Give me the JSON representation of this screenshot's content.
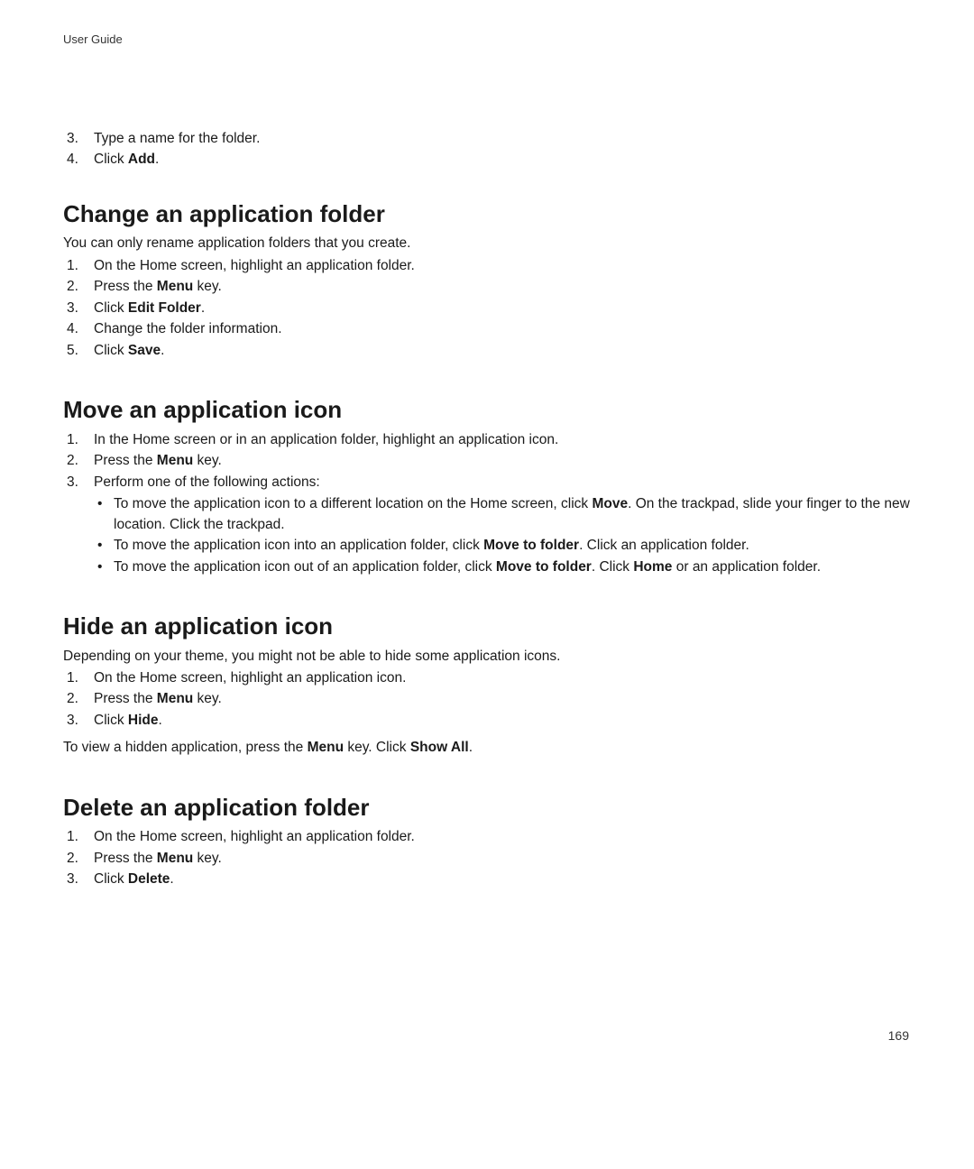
{
  "header": {
    "label": "User Guide"
  },
  "page_number": "169",
  "prelude_steps": {
    "start": 3,
    "items": [
      {
        "text": "Type a name for the folder."
      },
      {
        "runs": [
          {
            "t": "Click "
          },
          {
            "t": "Add",
            "b": true
          },
          {
            "t": "."
          }
        ]
      }
    ]
  },
  "sections": [
    {
      "heading": "Change an application folder",
      "intro": "You can only rename application folders that you create.",
      "steps": [
        {
          "text": "On the Home screen, highlight an application folder."
        },
        {
          "runs": [
            {
              "t": "Press the "
            },
            {
              "t": "Menu",
              "b": true
            },
            {
              "t": " key."
            }
          ]
        },
        {
          "runs": [
            {
              "t": "Click "
            },
            {
              "t": "Edit Folder",
              "b": true
            },
            {
              "t": "."
            }
          ]
        },
        {
          "text": "Change the folder information."
        },
        {
          "runs": [
            {
              "t": "Click "
            },
            {
              "t": "Save",
              "b": true
            },
            {
              "t": "."
            }
          ]
        }
      ]
    },
    {
      "heading": "Move an application icon",
      "steps": [
        {
          "text": "In the Home screen or in an application folder, highlight an application icon."
        },
        {
          "runs": [
            {
              "t": "Press the "
            },
            {
              "t": "Menu",
              "b": true
            },
            {
              "t": " key."
            }
          ]
        },
        {
          "text": "Perform one of the following actions:",
          "bullets": [
            {
              "runs": [
                {
                  "t": "To move the application icon to a different location on the Home screen, click "
                },
                {
                  "t": "Move",
                  "b": true
                },
                {
                  "t": ". On the trackpad, slide your finger to the new location. Click the trackpad."
                }
              ]
            },
            {
              "runs": [
                {
                  "t": "To move the application icon into an application folder, click "
                },
                {
                  "t": "Move to folder",
                  "b": true
                },
                {
                  "t": ". Click an application folder."
                }
              ]
            },
            {
              "runs": [
                {
                  "t": "To move the application icon out of an application folder, click "
                },
                {
                  "t": "Move to folder",
                  "b": true
                },
                {
                  "t": ". Click "
                },
                {
                  "t": "Home",
                  "b": true
                },
                {
                  "t": " or an application folder."
                }
              ]
            }
          ]
        }
      ]
    },
    {
      "heading": "Hide an application icon",
      "intro": "Depending on your theme, you might not be able to hide some application icons.",
      "steps": [
        {
          "text": "On the Home screen, highlight an application icon."
        },
        {
          "runs": [
            {
              "t": "Press the "
            },
            {
              "t": "Menu",
              "b": true
            },
            {
              "t": " key."
            }
          ]
        },
        {
          "runs": [
            {
              "t": "Click "
            },
            {
              "t": "Hide",
              "b": true
            },
            {
              "t": "."
            }
          ]
        }
      ],
      "note_runs": [
        {
          "t": "To view a hidden application, press the "
        },
        {
          "t": "Menu",
          "b": true
        },
        {
          "t": " key. Click "
        },
        {
          "t": "Show All",
          "b": true
        },
        {
          "t": "."
        }
      ]
    },
    {
      "heading": "Delete an application folder",
      "steps": [
        {
          "text": "On the Home screen, highlight an application folder."
        },
        {
          "runs": [
            {
              "t": "Press the "
            },
            {
              "t": "Menu",
              "b": true
            },
            {
              "t": " key."
            }
          ]
        },
        {
          "runs": [
            {
              "t": "Click "
            },
            {
              "t": "Delete",
              "b": true
            },
            {
              "t": "."
            }
          ]
        }
      ]
    }
  ]
}
